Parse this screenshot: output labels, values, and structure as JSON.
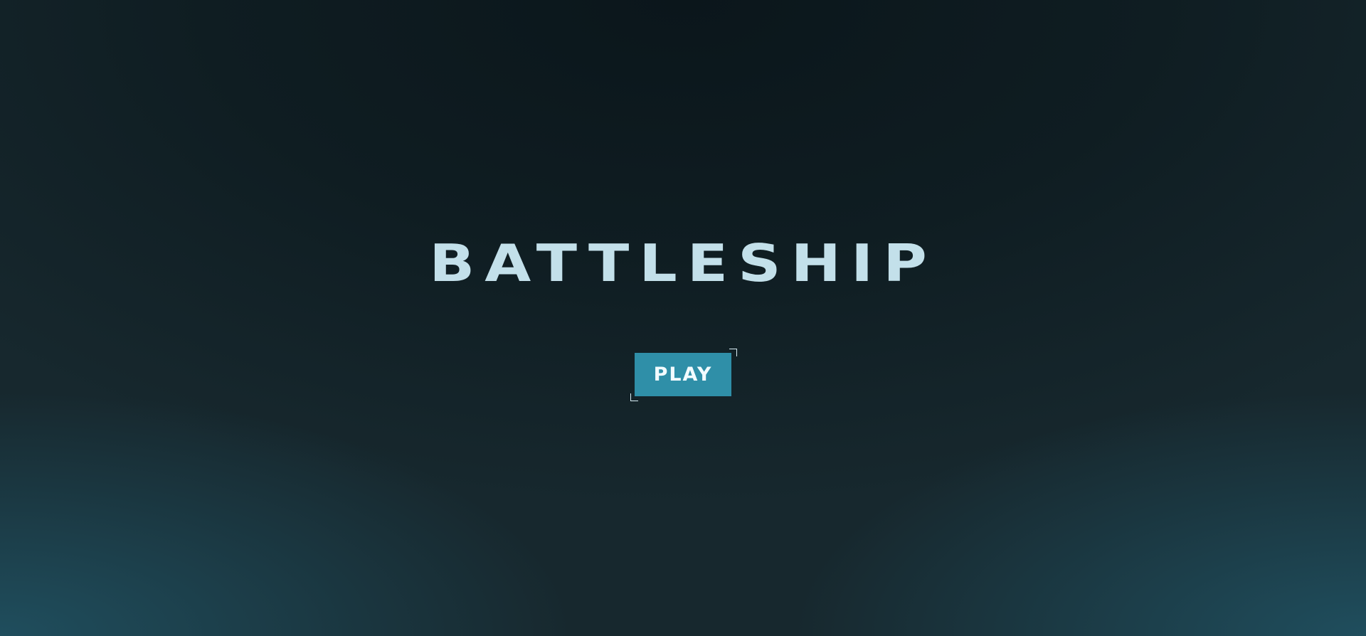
{
  "game": {
    "title": "BATTLESHIP",
    "play_label": "PLAY"
  },
  "colors": {
    "title": "#c3e0ea",
    "button_background": "#2f8fa8",
    "button_text": "#f2fbff",
    "background_dark": "#0b161b",
    "background_glow": "#205060"
  }
}
